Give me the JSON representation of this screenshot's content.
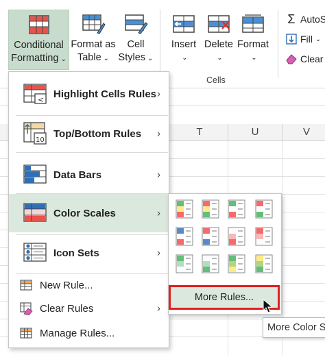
{
  "ribbon": {
    "conditional_formatting": {
      "line1": "Conditional",
      "line2": "Formatting",
      "chev": "⌄"
    },
    "format_as_table": {
      "line1": "Format as",
      "line2": "Table",
      "chev": "⌄"
    },
    "cell_styles": {
      "line1": "Cell",
      "line2": "Styles",
      "chev": "⌄"
    },
    "insert": {
      "label": "Insert",
      "chev": "⌄"
    },
    "delete": {
      "label": "Delete",
      "chev": "⌄"
    },
    "format": {
      "label": "Format",
      "chev": "⌄"
    },
    "cells_group_label": "Cells",
    "autosum_label": "AutoS",
    "fill_label": "Fill",
    "fill_chev": "⌄",
    "clear_label": "Clear"
  },
  "sheet": {
    "columns": [
      "T",
      "U",
      "V"
    ]
  },
  "menu": {
    "items": [
      {
        "label": "Highlight Cells Rules",
        "icon": "highlight-cells-icon"
      },
      {
        "label": "Top/Bottom Rules",
        "icon": "top-bottom-icon"
      },
      {
        "label": "Data Bars",
        "icon": "data-bars-icon"
      },
      {
        "label": "Color Scales",
        "icon": "color-scales-icon"
      },
      {
        "label": "Icon Sets",
        "icon": "icon-sets-icon"
      }
    ],
    "new_rule": "New Rule...",
    "clear_rules": "Clear Rules",
    "manage_rules": "Manage Rules...",
    "arrow": "›",
    "top_bottom_badge": "10"
  },
  "submenu": {
    "more_rules": "More Rules...",
    "tooltip": "More Color Scales"
  },
  "colors": {
    "accent_green": "#217346",
    "selected_bg": "#c8dccd",
    "hover_bg": "#dbe8de",
    "highlight_red": "#e02020"
  }
}
